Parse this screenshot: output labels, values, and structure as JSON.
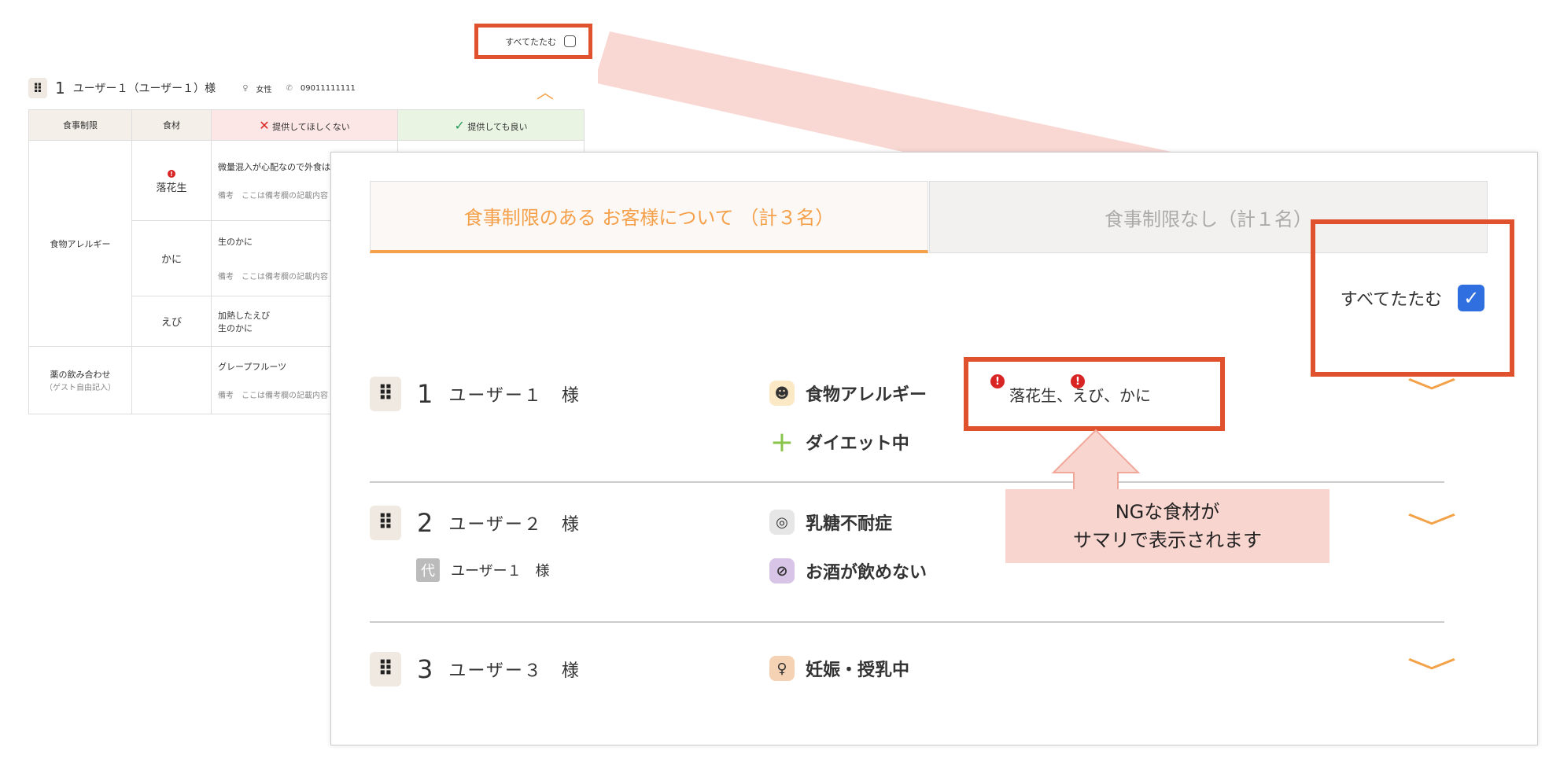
{
  "background_card": {
    "collapse_label": "すべてたたむ",
    "user_number": "1",
    "user_name": "ユーザー１（ユーザー１）様",
    "gender": "女性",
    "phone": "09011111111",
    "table_headers": [
      "食事制限",
      "食材",
      "提供してほしくない",
      "提供しても良い"
    ],
    "categories": [
      "食物アレルギー",
      "薬の飲み合わせ"
    ],
    "category_note": "（ゲスト自由記入）",
    "ingredients": [
      "落花生",
      "かに",
      "えび"
    ],
    "details": [
      "微量混入が心配なので外食は難",
      "生のかに",
      "加熱したえび",
      "生のかに",
      "グレープフルーツ"
    ],
    "note_label": "備考",
    "note_text": "ここは備考欄の記載内容"
  },
  "tabs": [
    {
      "label": "食事制限のある お客様について （計３名）"
    },
    {
      "label": "食事制限なし（計１名）"
    }
  ],
  "collapse_all": {
    "label": "すべてたたむ",
    "checked": true
  },
  "users": [
    {
      "number": "1",
      "name": "ユーザー１　様",
      "conditions": [
        "食物アレルギー",
        "ダイエット中"
      ],
      "ng_summary": "落花生、えび、かに"
    },
    {
      "number": "2",
      "name": "ユーザー２　様",
      "proxy_badge": "代",
      "proxy_name": "ユーザー１　様",
      "conditions": [
        "乳糖不耐症",
        "お酒が飲めない"
      ]
    },
    {
      "number": "3",
      "name": "ユーザー３　様",
      "conditions": [
        "妊娠・授乳中"
      ]
    }
  ],
  "callout": {
    "line1": "NGな食材が",
    "line2": "サマリで表示されます"
  },
  "colors": {
    "accent": "#f5a04a",
    "highlight": "#e0512e",
    "check": "#2f6fe0",
    "arrow": "#f9d5cf"
  }
}
